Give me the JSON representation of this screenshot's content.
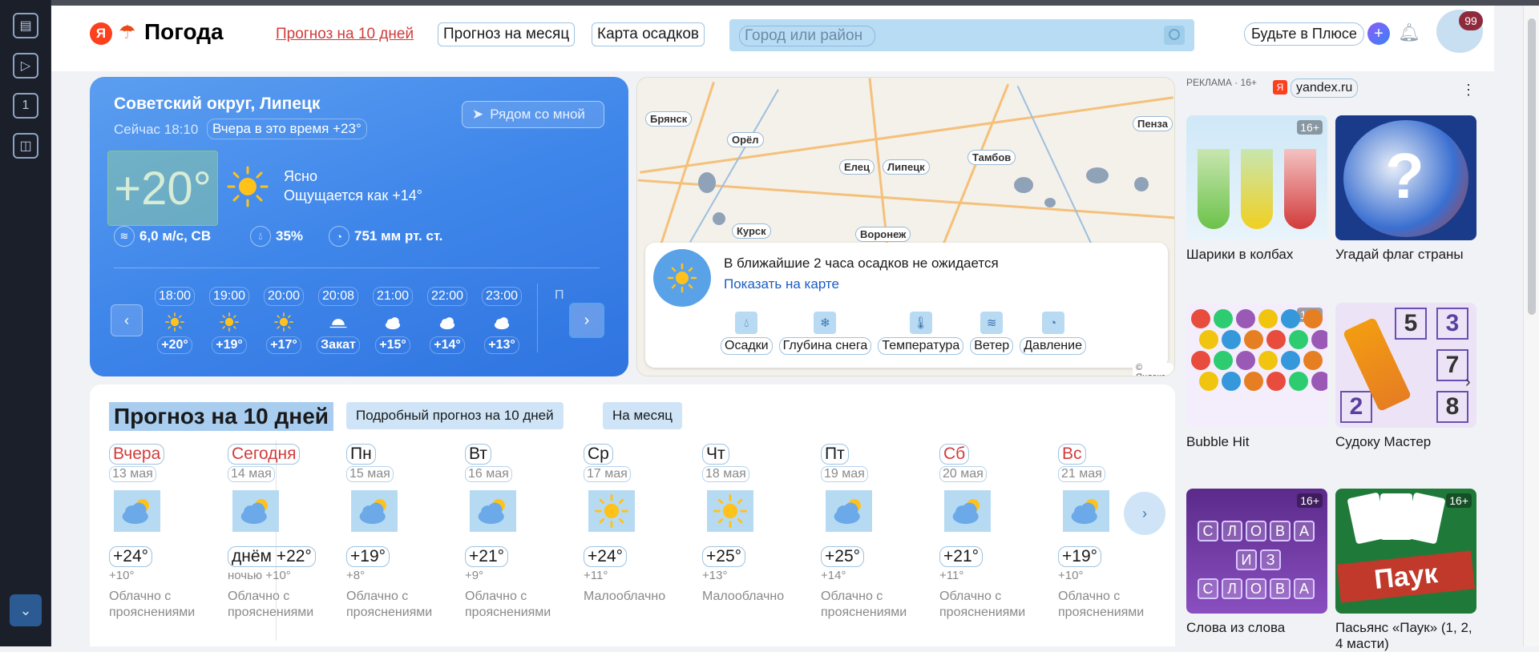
{
  "header": {
    "logo_y": "Я",
    "logo_text": "Погода",
    "nav": [
      "Прогноз на 10 дней",
      "Прогноз на месяц",
      "Карта осадков"
    ],
    "search_placeholder": "Город или район",
    "plus_label": "Будьте в Плюсе",
    "avatar_badge": "99"
  },
  "current": {
    "location": "Советский округ, Липецк",
    "nearby_label": "Рядом со мной",
    "now_time": "Сейчас 18:10",
    "yesterday": "Вчера в это время +23°",
    "temp": "+20°",
    "condition": "Ясно",
    "feels_like": "Ощущается как +14°",
    "wind": "6,0 м/с, СВ",
    "humidity": "35%",
    "pressure": "751 мм рт. ст.",
    "hours": [
      {
        "time": "18:00",
        "icon": "sun-icon",
        "temp": "+20°"
      },
      {
        "time": "19:00",
        "icon": "sun-icon",
        "temp": "+19°"
      },
      {
        "time": "20:00",
        "icon": "sun-icon",
        "temp": "+17°"
      },
      {
        "time": "20:08",
        "icon": "sunset-icon",
        "temp": "Закат"
      },
      {
        "time": "21:00",
        "icon": "moon-cloud-icon",
        "temp": "+15°"
      },
      {
        "time": "22:00",
        "icon": "moon-cloud-icon",
        "temp": "+14°"
      },
      {
        "time": "23:00",
        "icon": "moon-cloud-icon",
        "temp": "+13°"
      }
    ],
    "hours_next_label": "П"
  },
  "map": {
    "cities": [
      "Брянск",
      "Орёл",
      "Елец",
      "Липецк",
      "Тамбов",
      "Пенза",
      "Курск",
      "Воронеж"
    ],
    "message": "В ближайшие 2 часа осадков не ожидается",
    "show_on_map": "Показать на карте",
    "layers": [
      {
        "label": "Осадки",
        "icon": "drops-icon"
      },
      {
        "label": "Глубина снега",
        "icon": "snowflake-icon"
      },
      {
        "label": "Температура",
        "icon": "thermometer-icon"
      },
      {
        "label": "Ветер",
        "icon": "wind-icon"
      },
      {
        "label": "Давление",
        "icon": "gauge-icon"
      }
    ],
    "attribution": "© Яндекс"
  },
  "forecast": {
    "title": "Прогноз на 10 дней",
    "detail_button": "Подробный прогноз на 10 дней",
    "month_button": "На месяц",
    "days": [
      {
        "name": "Вчера",
        "date": "13 мая",
        "temp": "+24°",
        "low": "+10°",
        "cond": "Облачно с прояснениями",
        "weekend": true,
        "icon": "partly-cloudy-icon"
      },
      {
        "name": "Сегодня",
        "date": "14 мая",
        "temp": "днём +22°",
        "low": "ночью +10°",
        "cond": "Облачно с прояснениями",
        "weekend": true,
        "icon": "partly-cloudy-icon"
      },
      {
        "name": "Пн",
        "date": "15 мая",
        "temp": "+19°",
        "low": "+8°",
        "cond": "Облачно с прояснениями",
        "weekend": false,
        "icon": "partly-cloudy-icon"
      },
      {
        "name": "Вт",
        "date": "16 мая",
        "temp": "+21°",
        "low": "+9°",
        "cond": "Облачно с прояснениями",
        "weekend": false,
        "icon": "partly-cloudy-icon"
      },
      {
        "name": "Ср",
        "date": "17 мая",
        "temp": "+24°",
        "low": "+11°",
        "cond": "Малооблачно",
        "weekend": false,
        "icon": "sun-icon"
      },
      {
        "name": "Чт",
        "date": "18 мая",
        "temp": "+25°",
        "low": "+13°",
        "cond": "Малооблачно",
        "weekend": false,
        "icon": "sun-icon"
      },
      {
        "name": "Пт",
        "date": "19 мая",
        "temp": "+25°",
        "low": "+14°",
        "cond": "Облачно с прояснениями",
        "weekend": false,
        "icon": "partly-cloudy-icon"
      },
      {
        "name": "Сб",
        "date": "20 мая",
        "temp": "+21°",
        "low": "+11°",
        "cond": "Облачно с прояснениями",
        "weekend": true,
        "icon": "partly-cloudy-icon"
      },
      {
        "name": "Вс",
        "date": "21 мая",
        "temp": "+19°",
        "low": "+10°",
        "cond": "Облачно с прояснениями",
        "weekend": true,
        "icon": "partly-cloudy-icon"
      }
    ]
  },
  "ads": {
    "label": "РЕКЛАМА · 16+",
    "ya": "Я",
    "domain": "yandex.ru",
    "items": [
      {
        "caption": "Шарики в колбах",
        "age": "16+"
      },
      {
        "caption": "Угадай флаг страны",
        "age": ""
      },
      {
        "caption": "Bubble Hit",
        "age": "16+"
      },
      {
        "caption": "Судоку Мастер",
        "age": ""
      },
      {
        "caption": "Слова из слова",
        "age": "16+"
      },
      {
        "caption": "Пасьянс «Паук» (1, 2, 4 масти)",
        "age": "16+"
      }
    ],
    "sudoku_digits": [
      "5",
      "3",
      "7",
      "2",
      "8"
    ],
    "slova_letters": [
      "С",
      "Л",
      "О",
      "В",
      "А",
      "И",
      "З",
      "С",
      "Л",
      "О",
      "В",
      "А"
    ],
    "pauk_text": "Паук"
  },
  "colors": {
    "accent": "#3f86ea",
    "weekend": "#d23b3b",
    "link": "#1a5dc2",
    "brand": "#fc3f1d"
  }
}
